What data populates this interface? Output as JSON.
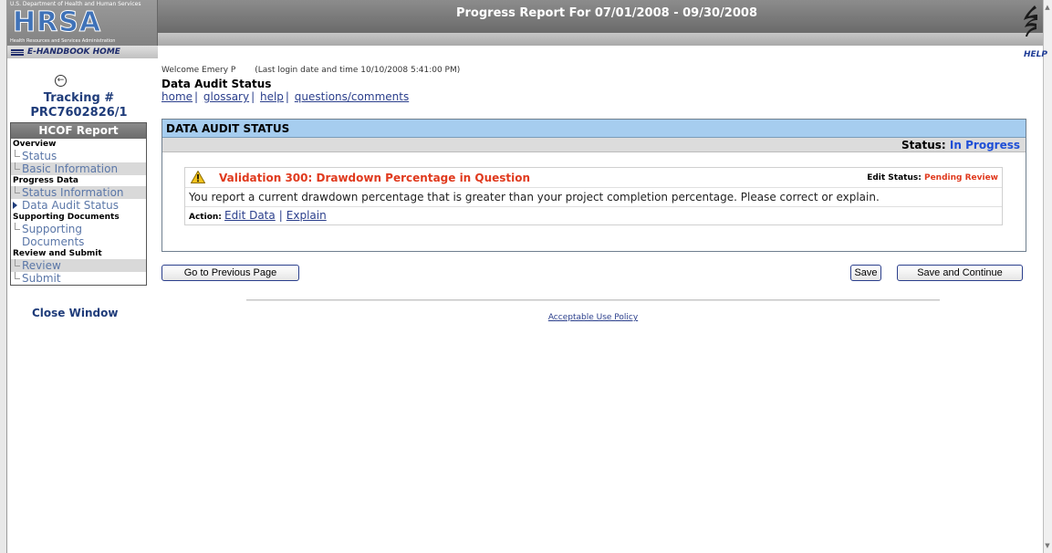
{
  "header": {
    "title": "Progress Report For 07/01/2008 - 09/30/2008",
    "logo_top": "U.S. Department of Health and Human Services",
    "logo_main": "HRSA",
    "logo_sub": "Health Resources and Services Administration",
    "ehandbook": "E-HANDBOOK HOME",
    "help": "HELP"
  },
  "sidebar": {
    "tracking_label": "Tracking #",
    "tracking_number": "PRC7602826/1",
    "report_title": "HCOF Report",
    "sections": [
      {
        "header": "Overview",
        "items": [
          {
            "label": "Status"
          },
          {
            "label": "Basic Information"
          }
        ]
      },
      {
        "header": "Progress Data",
        "items": [
          {
            "label": "Status Information"
          },
          {
            "label": "Data Audit Status"
          }
        ]
      },
      {
        "header": "Supporting Documents",
        "items": [
          {
            "label": "Supporting Documents"
          }
        ]
      },
      {
        "header": "Review and Submit",
        "items": [
          {
            "label": "Review"
          },
          {
            "label": "Submit"
          }
        ]
      }
    ],
    "close_window": "Close Window"
  },
  "main": {
    "welcome": "Welcome Emery P",
    "last_login": "(Last login date and time 10/10/2008 5:41:00 PM)",
    "page_title": "Data Audit Status",
    "breadcrumb": [
      "home",
      "glossary",
      "help",
      "questions/comments"
    ],
    "panel_title": "DATA AUDIT STATUS",
    "status_label": "Status:",
    "status_value": "In Progress",
    "validation": {
      "title": "Validation 300: Drawdown Percentage in Question",
      "edit_status_label": "Edit Status:",
      "edit_status_value": "Pending Review",
      "message": "You report a current drawdown percentage that is greater than your project completion percentage. Please correct or explain.",
      "action_label": "Action:",
      "actions": [
        "Edit Data",
        "Explain"
      ]
    },
    "buttons": {
      "previous": "Go to Previous Page",
      "save": "Save",
      "save_continue": "Save and Continue"
    },
    "footer_link": "Acceptable Use Policy"
  },
  "colors": {
    "panel_header": "#a6cdef",
    "status_value": "#1f4fd6",
    "warning_text": "#e03a1e",
    "link": "#2b3f8c"
  }
}
